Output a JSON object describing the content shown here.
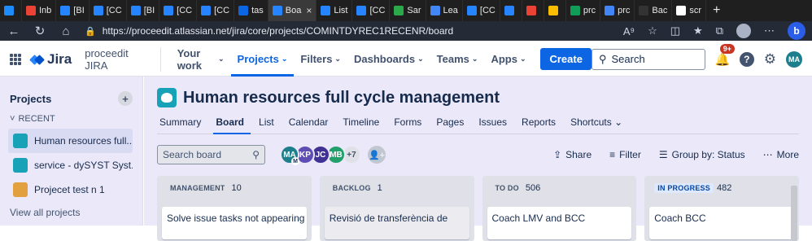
{
  "browser": {
    "tabs": [
      {
        "label": "",
        "color": "#1d8cf8"
      },
      {
        "label": "Inb",
        "color": "#ea4335"
      },
      {
        "label": "[BI",
        "color": "#2684ff"
      },
      {
        "label": "[CC",
        "color": "#2684ff"
      },
      {
        "label": "[BI",
        "color": "#2684ff"
      },
      {
        "label": "[CC",
        "color": "#2684ff"
      },
      {
        "label": "[CC",
        "color": "#2684ff"
      },
      {
        "label": "tas",
        "color": "#0c66e4"
      },
      {
        "label": "Boa",
        "color": "#2684ff"
      },
      {
        "label": "List",
        "color": "#2684ff"
      },
      {
        "label": "[CC",
        "color": "#2684ff"
      },
      {
        "label": "Sar",
        "color": "#2ba84a"
      },
      {
        "label": "Lea",
        "color": "#4285f4"
      },
      {
        "label": "[CC",
        "color": "#2684ff"
      },
      {
        "label": "",
        "color": "#2684ff"
      },
      {
        "label": "",
        "color": "#ea4335"
      },
      {
        "label": "",
        "color": "#fbbc04"
      },
      {
        "label": "prc",
        "color": "#0f9d58"
      },
      {
        "label": "prc",
        "color": "#4285f4"
      },
      {
        "label": "Bac",
        "color": "#333333"
      },
      {
        "label": "scr",
        "color": "#ffffff"
      }
    ],
    "active_tab_index": 8,
    "new_tab": "+",
    "url": "https://proceedit.atlassian.net/jira/core/projects/COMINTDYREC1RECENR/board"
  },
  "topnav": {
    "product": "Jira",
    "site": "proceedit JIRA",
    "items": [
      {
        "label": "Your work",
        "active": false
      },
      {
        "label": "Projects",
        "active": true
      },
      {
        "label": "Filters",
        "active": false
      },
      {
        "label": "Dashboards",
        "active": false
      },
      {
        "label": "Teams",
        "active": false
      },
      {
        "label": "Apps",
        "active": false
      }
    ],
    "create_label": "Create",
    "search_placeholder": "Search",
    "notification_count": "9+",
    "user_initials": "MA"
  },
  "sidebar": {
    "title": "Projects",
    "recent_label": "RECENT",
    "items": [
      {
        "label": "Human resources full...",
        "selected": true,
        "color": "#17a2b8"
      },
      {
        "label": "service - dySYST Syst...",
        "selected": false,
        "color": "#17a2b8"
      },
      {
        "label": "Projecet test n 1",
        "selected": false,
        "color": "#e2a03f"
      }
    ],
    "view_all": "View all projects"
  },
  "project": {
    "name": "Human resources full cycle management",
    "tabs": [
      {
        "label": "Summary",
        "active": false
      },
      {
        "label": "Board",
        "active": true
      },
      {
        "label": "List",
        "active": false
      },
      {
        "label": "Calendar",
        "active": false
      },
      {
        "label": "Timeline",
        "active": false
      },
      {
        "label": "Forms",
        "active": false
      },
      {
        "label": "Pages",
        "active": false
      },
      {
        "label": "Issues",
        "active": false
      },
      {
        "label": "Reports",
        "active": false
      },
      {
        "label": "Shortcuts",
        "active": false
      }
    ]
  },
  "board": {
    "search_placeholder": "Search board",
    "avatars": [
      {
        "initials": "MA",
        "color": "#1d7f8c",
        "sub": "M"
      },
      {
        "initials": "KP",
        "color": "#5e4db2"
      },
      {
        "initials": "JC",
        "color": "#403294"
      },
      {
        "initials": "MB",
        "color": "#22a06b"
      }
    ],
    "more_avatars": "+7",
    "actions": {
      "share": "Share",
      "filter": "Filter",
      "group_by": "Group by: Status",
      "more": "More"
    },
    "columns": [
      {
        "status": "MANAGEMENT",
        "count": "10",
        "card": "Solve issue tasks not appearing",
        "blue": false
      },
      {
        "status": "BACKLOG",
        "count": "1",
        "card": "Revisió de transferència de",
        "blue": false
      },
      {
        "status": "TO DO",
        "count": "506",
        "card": "Coach LMV and BCC",
        "blue": false
      },
      {
        "status": "IN PROGRESS",
        "count": "482",
        "card": "Coach BCC",
        "blue": true
      }
    ]
  }
}
